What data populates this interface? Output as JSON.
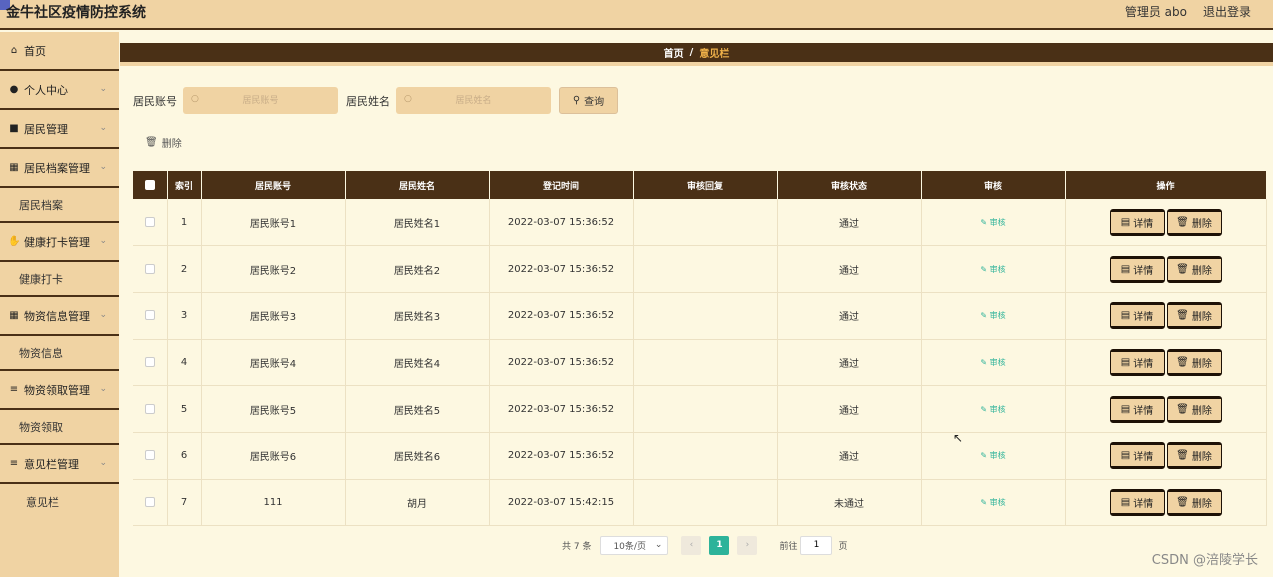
{
  "header": {
    "app_title": "金牛社区疫情防控系统",
    "user_label": "管理员 abo",
    "logout_label": "退出登录"
  },
  "sidebar": {
    "items": [
      {
        "label": "首页",
        "icon": "home-icon"
      },
      {
        "label": "个人中心",
        "icon": "user-icon"
      },
      {
        "label": "居民管理",
        "icon": "briefcase-icon"
      },
      {
        "label": "居民档案管理",
        "icon": "grid-icon"
      },
      {
        "label": "居民档案"
      },
      {
        "label": "健康打卡管理",
        "icon": "thumbs-up-icon"
      },
      {
        "label": "健康打卡"
      },
      {
        "label": "物资信息管理",
        "icon": "grid-icon"
      },
      {
        "label": "物资信息"
      },
      {
        "label": "物资领取管理",
        "icon": "list-icon"
      },
      {
        "label": "物资领取"
      },
      {
        "label": "意见栏管理",
        "icon": "list-icon"
      },
      {
        "label": "意见栏"
      }
    ]
  },
  "breadcrumb": {
    "home": "首页",
    "separator": "/",
    "current": "意见栏"
  },
  "search": {
    "account_label": "居民账号",
    "account_placeholder": "居民账号",
    "name_label": "居民姓名",
    "name_placeholder": "居民姓名",
    "query_label": "查询"
  },
  "toolbar": {
    "delete_label": "删除"
  },
  "table": {
    "headers": [
      "索引",
      "居民账号",
      "居民姓名",
      "登记时间",
      "审核回复",
      "审核状态",
      "审核",
      "操作"
    ],
    "review_label": "审核",
    "detail_label": "详情",
    "delete_label": "删除",
    "rows": [
      {
        "index": "1",
        "account": "居民账号1",
        "name": "居民姓名1",
        "time": "2022-03-07 15:36:52",
        "reply": "",
        "status": "通过"
      },
      {
        "index": "2",
        "account": "居民账号2",
        "name": "居民姓名2",
        "time": "2022-03-07 15:36:52",
        "reply": "",
        "status": "通过"
      },
      {
        "index": "3",
        "account": "居民账号3",
        "name": "居民姓名3",
        "time": "2022-03-07 15:36:52",
        "reply": "",
        "status": "通过"
      },
      {
        "index": "4",
        "account": "居民账号4",
        "name": "居民姓名4",
        "time": "2022-03-07 15:36:52",
        "reply": "",
        "status": "通过"
      },
      {
        "index": "5",
        "account": "居民账号5",
        "name": "居民姓名5",
        "time": "2022-03-07 15:36:52",
        "reply": "",
        "status": "通过"
      },
      {
        "index": "6",
        "account": "居民账号6",
        "name": "居民姓名6",
        "time": "2022-03-07 15:36:52",
        "reply": "",
        "status": "通过"
      },
      {
        "index": "7",
        "account": "111",
        "name": "胡月",
        "time": "2022-03-07 15:42:15",
        "reply": "",
        "status": "未通过"
      }
    ]
  },
  "pagination": {
    "total": "共 7 条",
    "page_size": "10条/页",
    "current_page": "1",
    "goto_prefix": "前往",
    "goto_value": "1",
    "goto_suffix": "页"
  },
  "watermark": "CSDN @涪陵学长",
  "colors": {
    "header_bg": "#f0d3a3",
    "dark_brown": "#4a3016",
    "page_bg": "#fdf8e1",
    "accent_teal": "#2db39a",
    "crumb_current": "#f0b24a"
  }
}
